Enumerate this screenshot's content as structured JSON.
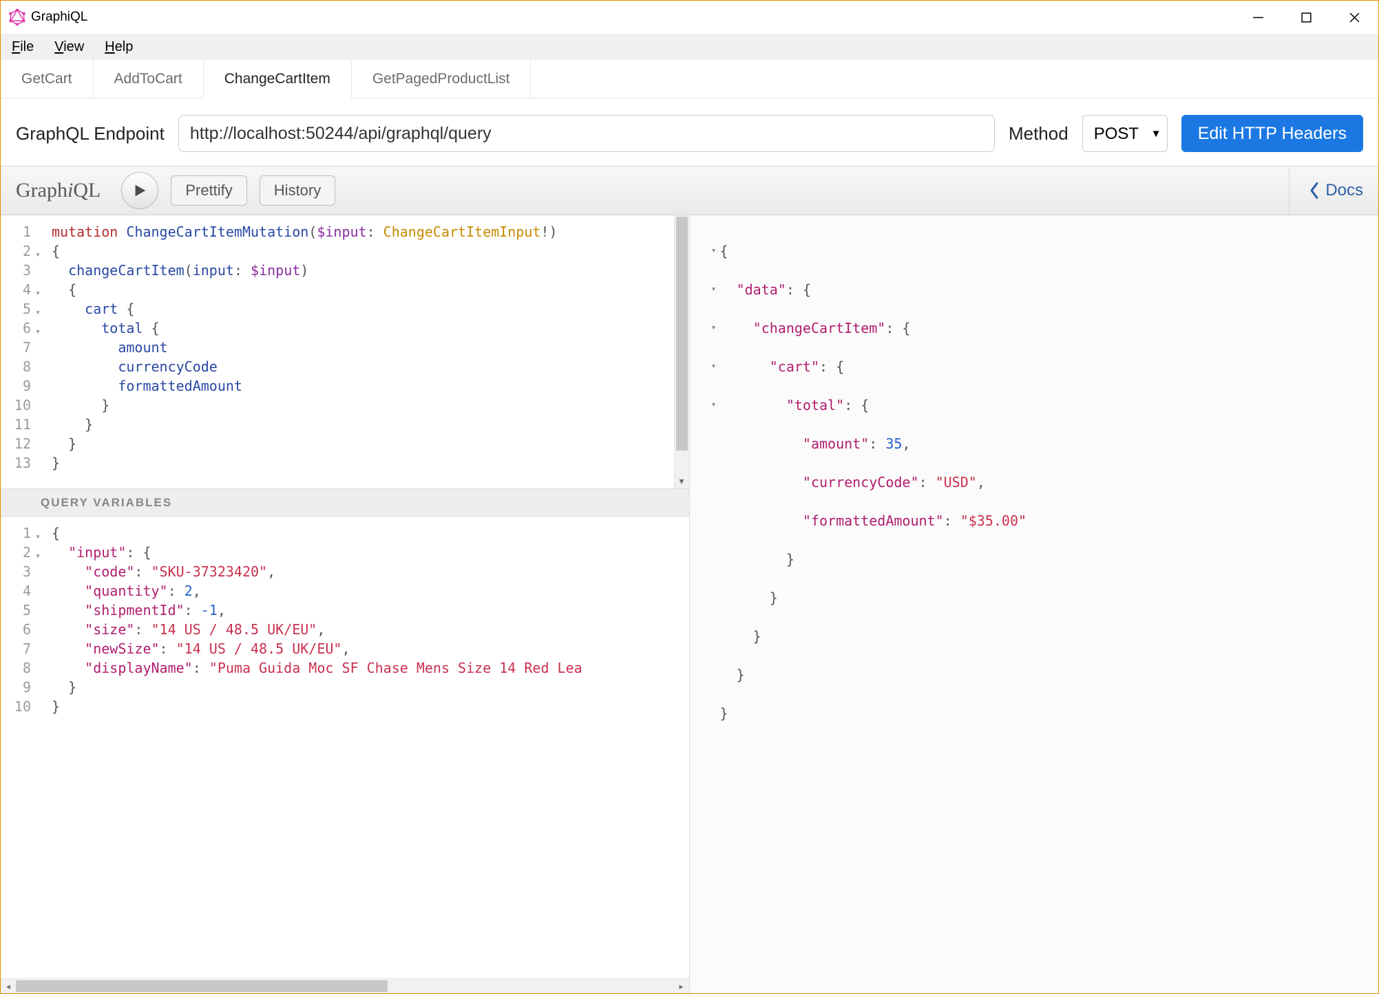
{
  "window": {
    "title": "GraphiQL"
  },
  "menubar": {
    "file": "File",
    "view": "View",
    "help": "Help"
  },
  "tabs": [
    {
      "label": "GetCart",
      "active": false
    },
    {
      "label": "AddToCart",
      "active": false
    },
    {
      "label": "ChangeCartItem",
      "active": true
    },
    {
      "label": "GetPagedProductList",
      "active": false
    }
  ],
  "endpoint": {
    "label": "GraphQL Endpoint",
    "value": "http://localhost:50244/api/graphql/query",
    "method_label": "Method",
    "method_value": "POST",
    "edit_headers": "Edit HTTP Headers"
  },
  "toolbar": {
    "logo": "GraphiQL",
    "prettify": "Prettify",
    "history": "History",
    "docs": "Docs"
  },
  "query": {
    "lines": [
      "1",
      "2",
      "3",
      "4",
      "5",
      "6",
      "7",
      "8",
      "9",
      "10",
      "11",
      "12",
      "13"
    ],
    "fold_lines": [
      2,
      4,
      5,
      6
    ],
    "tokens": {
      "kw_mutation": "mutation",
      "op_name": "ChangeCartItemMutation",
      "var_input": "$input",
      "type_input": "ChangeCartItemInput",
      "field_change": "changeCartItem",
      "arg_input": "input",
      "field_cart": "cart",
      "field_total": "total",
      "field_amount": "amount",
      "field_currency": "currencyCode",
      "field_formatted": "formattedAmount"
    }
  },
  "qv_header": "QUERY VARIABLES",
  "variables": {
    "lines": [
      "1",
      "2",
      "3",
      "4",
      "5",
      "6",
      "7",
      "8",
      "9",
      "10"
    ],
    "fold_lines": [
      1,
      2
    ],
    "data": {
      "k_input": "\"input\"",
      "k_code": "\"code\"",
      "v_code": "\"SKU-37323420\"",
      "k_quantity": "\"quantity\"",
      "v_quantity": "2",
      "k_shipment": "\"shipmentId\"",
      "v_shipment": "-1",
      "k_size": "\"size\"",
      "v_size": "\"14 US / 48.5 UK/EU\"",
      "k_newsize": "\"newSize\"",
      "v_newsize": "\"14 US / 48.5 UK/EU\"",
      "k_display": "\"displayName\"",
      "v_display": "\"Puma Guida Moc SF Chase Mens Size 14 Red Lea"
    }
  },
  "result": {
    "k_data": "\"data\"",
    "k_change": "\"changeCartItem\"",
    "k_cart": "\"cart\"",
    "k_total": "\"total\"",
    "k_amount": "\"amount\"",
    "v_amount": "35",
    "k_currency": "\"currencyCode\"",
    "v_currency": "\"USD\"",
    "k_formatted": "\"formattedAmount\"",
    "v_formatted": "\"$35.00\""
  }
}
